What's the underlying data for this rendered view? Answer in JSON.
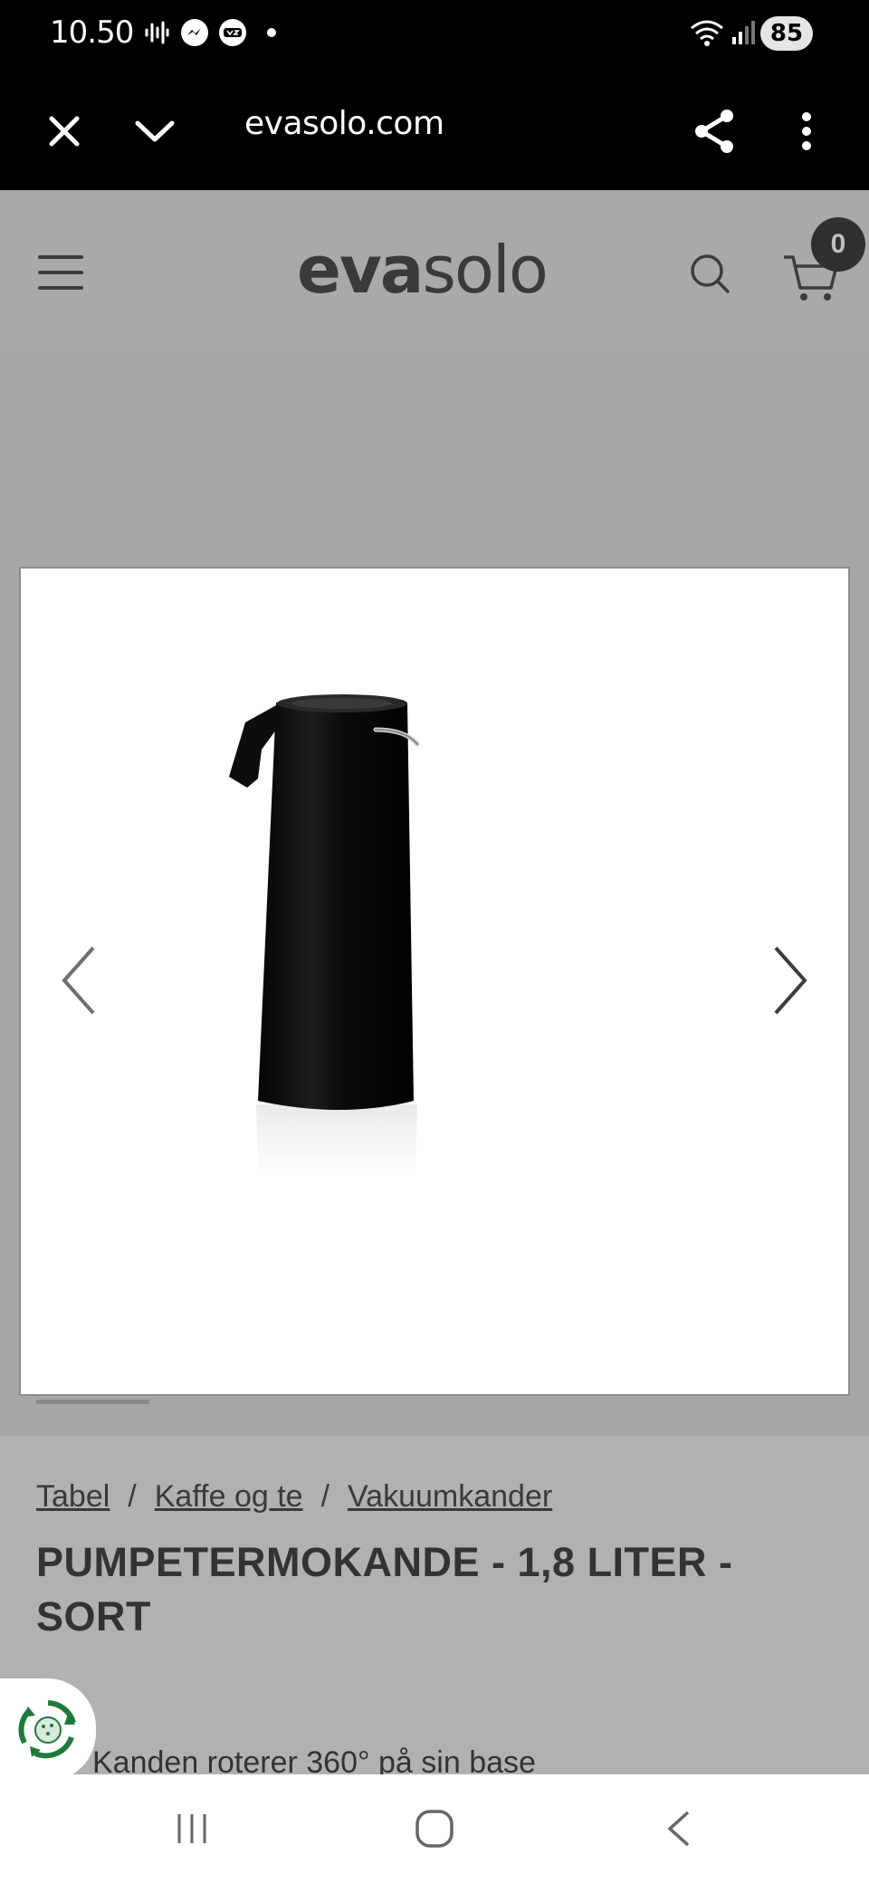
{
  "status_bar": {
    "time": "10.50",
    "notifications": [
      "waveform-icon",
      "messenger-icon",
      "tv2-icon",
      "dot-icon"
    ],
    "battery": "85"
  },
  "browser": {
    "url": "evasolo.com"
  },
  "site": {
    "logo_bold": "eva",
    "logo_light": "solo",
    "cart_count": "0"
  },
  "product": {
    "breadcrumbs": [
      "Tabel",
      "Kaffe og te",
      "Vakuumkander"
    ],
    "breadcrumb_separator": "/",
    "title": "PUMPETERMOKANDE - 1,8 LITER - SORT",
    "feature": "Kanden roterer 360° på sin base"
  }
}
